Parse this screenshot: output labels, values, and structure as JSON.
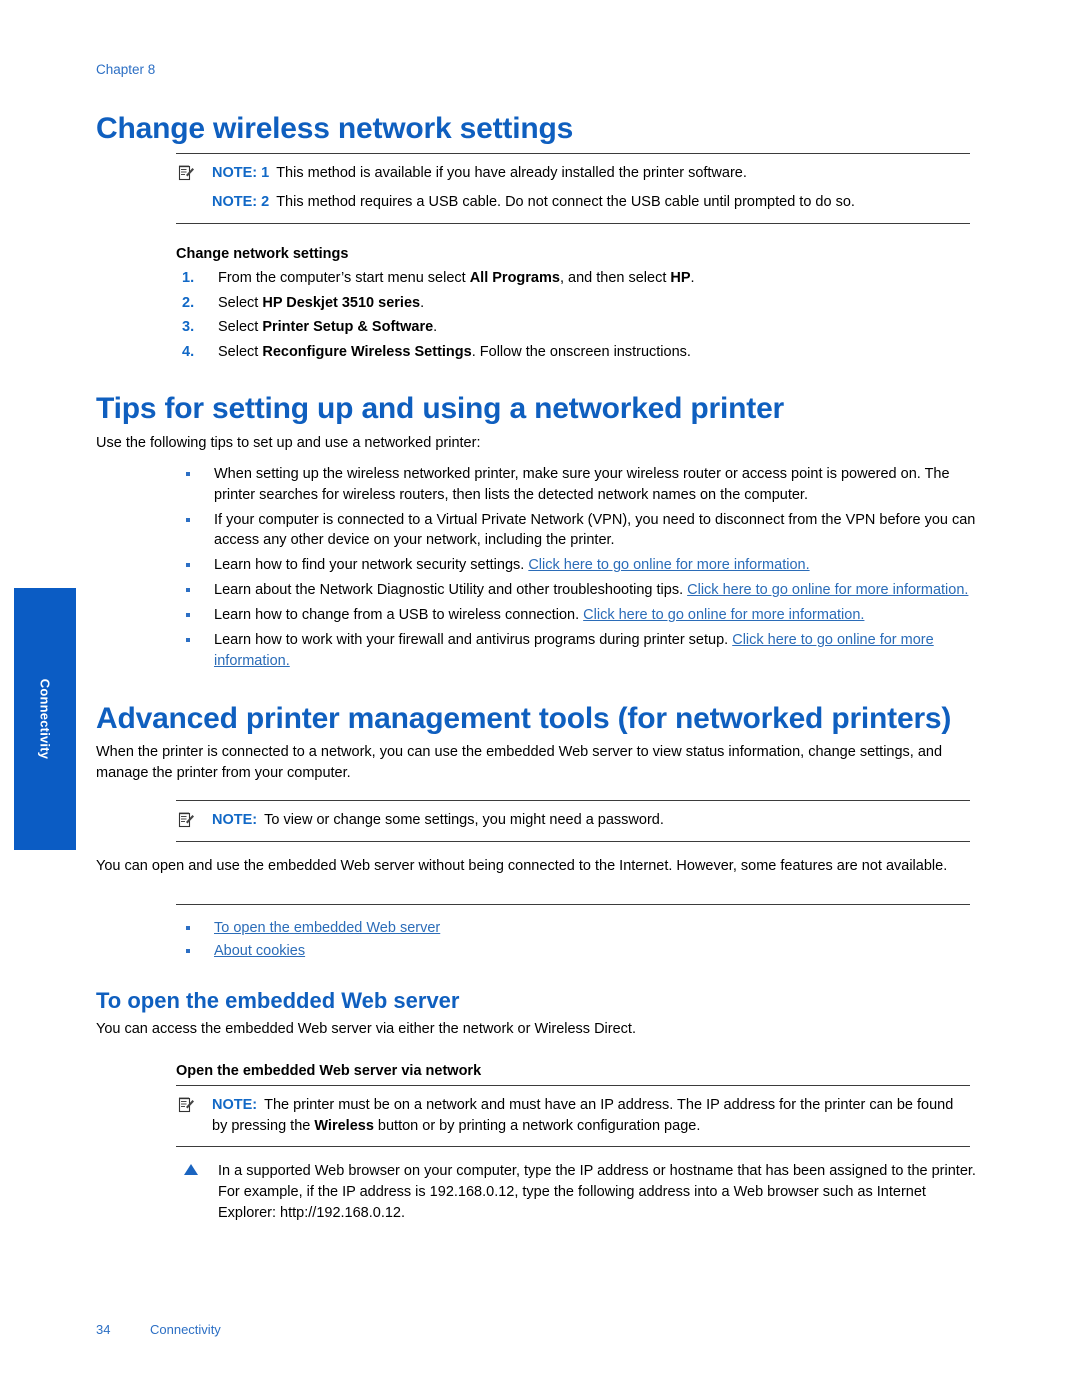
{
  "page": {
    "chapter_label": "Chapter 8",
    "footer_page_number": "34",
    "footer_section": "Connectivity",
    "side_tab_label": "Connectivity",
    "accent_heading_color": "#0F5FBF",
    "accent_link_color": "#2B6CB8",
    "side_tab_color": "#0B5CC4",
    "note_word_color": "#1168C6"
  },
  "section1": {
    "heading": "Change wireless network settings",
    "notes": [
      {
        "icon": "note-pad-icon",
        "label": "NOTE: 1",
        "text": "This method is available if you have already installed the printer software."
      },
      {
        "icon": "",
        "label": "NOTE: 2",
        "text": "This method requires a USB cable. Do not connect the USB cable until prompted to do so."
      }
    ],
    "procedure_title": "Change network settings",
    "steps": [
      {
        "num": "1.",
        "pre": "From the computer’s start menu select ",
        "bold": "All Programs",
        "mid": ", and then select ",
        "bold2": "HP",
        "post": "."
      },
      {
        "num": "2.",
        "pre": "Select ",
        "bold": "HP Deskjet 3510 series",
        "mid": "",
        "bold2": "",
        "post": "."
      },
      {
        "num": "3.",
        "pre": "Select ",
        "bold": "Printer Setup & Software",
        "mid": "",
        "bold2": "",
        "post": "."
      },
      {
        "num": "4.",
        "pre": "Select ",
        "bold": "Reconfigure Wireless Settings",
        "mid": ". Follow the onscreen instructions.",
        "bold2": "",
        "post": ""
      }
    ]
  },
  "section2": {
    "heading": "Tips for setting up and using a networked printer",
    "intro": "Use the following tips to set up and use a networked printer:",
    "bullets": [
      {
        "text": "When setting up the wireless networked printer, make sure your wireless router or access point is powered on. The printer searches for wireless routers, then lists the detected network names on the computer.",
        "link": ""
      },
      {
        "text": "If your computer is connected to a Virtual Private Network (VPN), you need to disconnect from the VPN before you can access any other device on your network, including the printer.",
        "link": ""
      },
      {
        "text": "Learn how to find your network security settings. ",
        "link": "Click here to go online for more information."
      },
      {
        "text": "Learn about the Network Diagnostic Utility and other troubleshooting tips. ",
        "link": "Click here to go online for more information."
      },
      {
        "text": "Learn how to change from a USB to wireless connection. ",
        "link": "Click here to go online for more information."
      },
      {
        "text": "Learn how to work with your firewall and antivirus programs during printer setup. ",
        "link": "Click here to go online for more information."
      }
    ]
  },
  "section3": {
    "heading": "Advanced printer management tools (for networked printers)",
    "intro": "When the printer is connected to a network, you can use the embedded Web server to view status information, change settings, and manage the printer from your computer.",
    "note": {
      "icon": "note-pad-icon",
      "label": "NOTE:",
      "text": "To view or change some settings, you might need a password."
    },
    "body": "You can open and use the embedded Web server without being connected to the Internet. However, some features are not available.",
    "toc_links": [
      "To open the embedded Web server",
      "About cookies"
    ]
  },
  "section4": {
    "heading": "To open the embedded Web server",
    "intro": "You can access the embedded Web server via either the network or Wireless Direct.",
    "procedure_title": "Open the embedded Web server via network",
    "note": {
      "icon": "note-pad-icon",
      "label": "NOTE:",
      "pre": "The printer must be on a network and must have an IP address. The IP address for the printer can be found by pressing the ",
      "bold": "Wireless",
      "post": " button or by printing a network configuration page."
    },
    "step": {
      "icon": "triangle-up-icon",
      "line1": "In a supported Web browser on your computer, type the IP address or hostname that has been assigned to the printer.",
      "line2": "For example, if the IP address is 192.168.0.12, type the following address into a Web browser such as Internet Explorer: http://192.168.0.12."
    }
  }
}
